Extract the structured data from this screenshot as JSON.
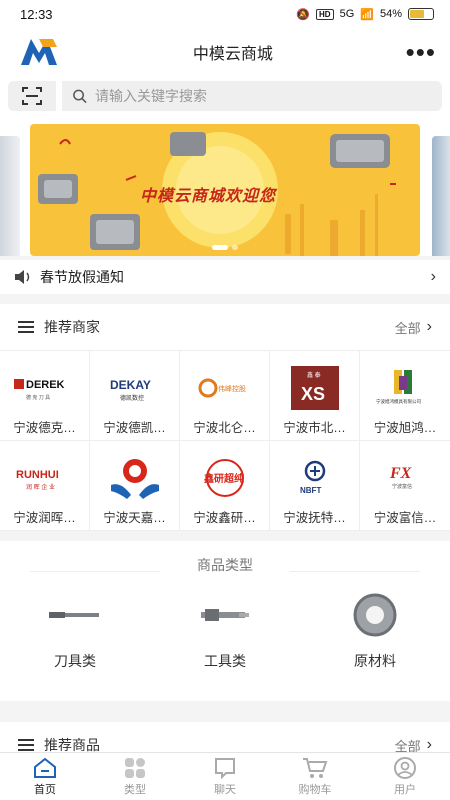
{
  "status": {
    "time": "12:33",
    "hd": "HD",
    "network": "5G",
    "battery": "54%"
  },
  "header": {
    "title": "中模云商城",
    "more": "•••"
  },
  "search": {
    "placeholder": "请输入关键字搜索"
  },
  "banner": {
    "text": "中模云商城欢迎您"
  },
  "notice": {
    "text": "春节放假通知"
  },
  "merchants": {
    "title": "推荐商家",
    "all": "全部",
    "items": [
      {
        "name": "宁波德克…",
        "logo_text": "DEREK",
        "logo_sub": "德 克 刀 具"
      },
      {
        "name": "宁波德凯…",
        "logo_text": "DEKAY",
        "logo_sub": "德凯数控"
      },
      {
        "name": "宁波北仑…",
        "logo_text": "伟峰控股"
      },
      {
        "name": "宁波市北…",
        "logo_text": "XS",
        "logo_sub": "鑫 泰"
      },
      {
        "name": "宁波旭鸿…",
        "logo_text": "宁波旭鸿模具有限公司"
      },
      {
        "name": "宁波润晖…",
        "logo_text": "RUNHUI",
        "logo_sub": "润 晖 企 业"
      },
      {
        "name": "宁波天嘉…",
        "logo_text": ""
      },
      {
        "name": "宁波鑫研…",
        "logo_text": "鑫研超纯"
      },
      {
        "name": "宁波抚特…",
        "logo_text": "NBFT"
      },
      {
        "name": "宁波富信…",
        "logo_text": "FX",
        "logo_sub": "宁波富信"
      }
    ]
  },
  "categories": {
    "title": "商品类型",
    "items": [
      {
        "label": "刀具类"
      },
      {
        "label": "工具类"
      },
      {
        "label": "原材料"
      }
    ]
  },
  "recommend": {
    "title": "推荐商品",
    "all": "全部"
  },
  "tabs": [
    {
      "label": "首页",
      "icon": "home-icon"
    },
    {
      "label": "类型",
      "icon": "grid-icon"
    },
    {
      "label": "聊天",
      "icon": "chat-icon"
    },
    {
      "label": "购物车",
      "icon": "cart-icon"
    },
    {
      "label": "用户",
      "icon": "user-icon"
    }
  ],
  "colors": {
    "brand_blue": "#1f64b4",
    "banner_yellow": "#f8c33a",
    "banner_red": "#c7261a"
  }
}
